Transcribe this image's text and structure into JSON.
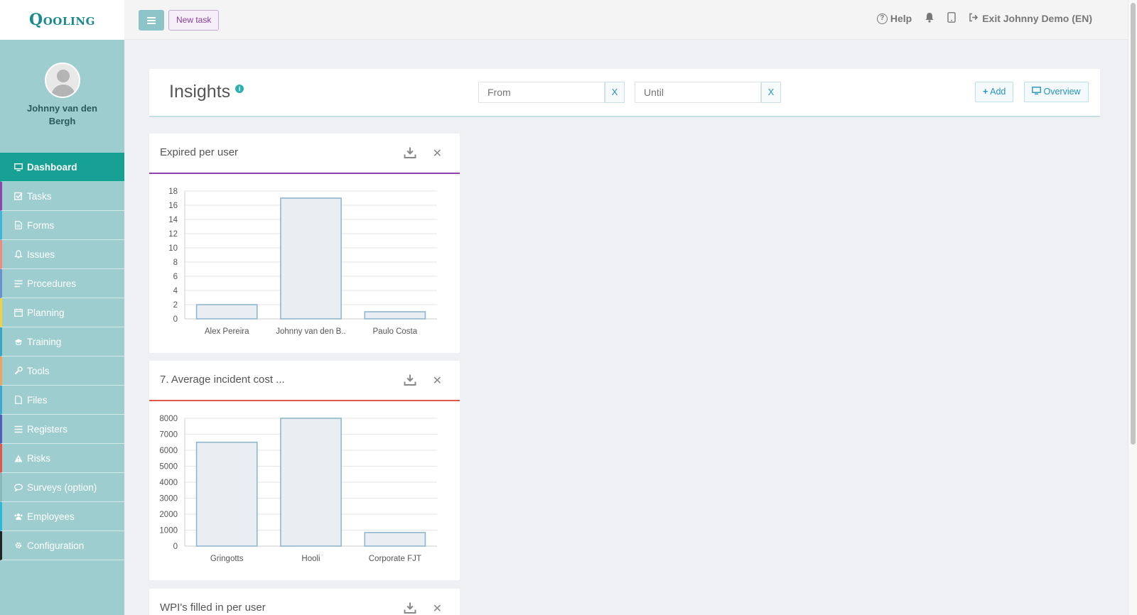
{
  "brand": {
    "logo_text": "Qooling"
  },
  "profile": {
    "name": "Johnny van den Bergh"
  },
  "sidebar": {
    "items": [
      {
        "label": "Dashboard",
        "icon": "monitor-icon",
        "accent": "#17a195",
        "active": true
      },
      {
        "label": "Tasks",
        "icon": "checkbox-icon",
        "accent": "#8e44ad"
      },
      {
        "label": "Forms",
        "icon": "document-icon",
        "accent": "#3cb6d8"
      },
      {
        "label": "Issues",
        "icon": "bell-icon",
        "accent": "#ee8a7e"
      },
      {
        "label": "Procedures",
        "icon": "list-icon",
        "accent": "#6b8fcf"
      },
      {
        "label": "Planning",
        "icon": "calendar-icon",
        "accent": "#f2d23b"
      },
      {
        "label": "Training",
        "icon": "graduation-cap-icon",
        "accent": "#37a6c7"
      },
      {
        "label": "Tools",
        "icon": "wrench-icon",
        "accent": "#f0a35a"
      },
      {
        "label": "Files",
        "icon": "file-icon",
        "accent": "#3aa7d6"
      },
      {
        "label": "Registers",
        "icon": "bars-icon",
        "accent": "#4e5cba"
      },
      {
        "label": "Risks",
        "icon": "warning-icon",
        "accent": "#e35649"
      },
      {
        "label": "Surveys (option)",
        "icon": "comment-icon",
        "accent": "#8ab8b9"
      },
      {
        "label": "Employees",
        "icon": "users-icon",
        "accent": "#28b7dd"
      },
      {
        "label": "Configuration",
        "icon": "gear-icon",
        "accent": "#222222"
      }
    ]
  },
  "topbar": {
    "new_task_label": "New task",
    "help_label": "Help",
    "exit_label": "Exit Johnny Demo (EN)"
  },
  "insights": {
    "title": "Insights",
    "from_placeholder": "From",
    "until_placeholder": "Until",
    "clear_label": "X",
    "add_label": "Add",
    "overview_label": "Overview"
  },
  "cards": [
    {
      "title": "Expired per user",
      "accent": "#8e44ad"
    },
    {
      "title": "7. Average incident cost ...",
      "accent": "#e35649"
    },
    {
      "title": "WPI's filled in per user",
      "accent": "#3cb6d8"
    }
  ],
  "chart_data": [
    {
      "type": "bar",
      "title": "Expired per user",
      "categories": [
        "Alex Pereira",
        "Johnny van den B..",
        "Paulo Costa"
      ],
      "values": [
        2,
        17,
        1
      ],
      "ylim": [
        0,
        18
      ],
      "yticks": [
        0,
        2,
        4,
        6,
        8,
        10,
        12,
        14,
        16,
        18
      ],
      "grid": true
    },
    {
      "type": "bar",
      "title": "7. Average incident cost ...",
      "categories": [
        "Gringotts",
        "Hooli",
        "Corporate FJT"
      ],
      "values": [
        6500,
        8000,
        850
      ],
      "ylim": [
        0,
        8000
      ],
      "yticks": [
        0,
        1000,
        2000,
        3000,
        4000,
        5000,
        6000,
        7000,
        8000
      ],
      "grid": true
    }
  ]
}
